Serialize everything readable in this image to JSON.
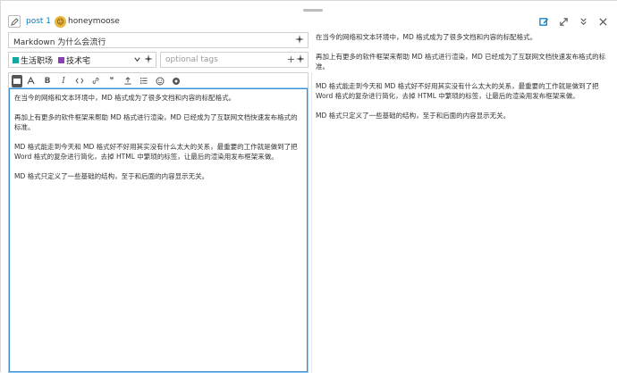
{
  "reply": {
    "post_label": "post 1",
    "username": "honeymoose",
    "avatar_glyph": "☺"
  },
  "title": {
    "value": "Markdown 为什么会流行"
  },
  "category": {
    "chips": [
      {
        "label": "生活职场",
        "color": "#12a89d"
      },
      {
        "label": "技术宅",
        "color": "#8c3fb5"
      }
    ]
  },
  "tags": {
    "placeholder": "optional tags"
  },
  "toolbar": {
    "icons": [
      "toggle-editor-icon",
      "bold-icon",
      "italic-icon",
      "link-icon",
      "quote-icon",
      "upload-icon",
      "list-icon",
      "emoji-icon",
      "options-icon"
    ],
    "bold_glyph": "B",
    "italic_glyph": "I",
    "quote_glyph": "❞"
  },
  "content": {
    "paragraphs": [
      "在当今的网络和文本环境中，MD 格式成为了很多文档和内容的标配格式。",
      "再加上有更多的软件框架来帮助 MD 格式进行渲染，MD 已经成为了互联网文档快速发布格式的标准。",
      "MD 格式能走到今天和 MD 格式好不好用其实没有什么太大的关系，最重要的工作就是做到了把 Word 格式的复杂进行简化，去掉 HTML 中繁琐的标签，让最后的渲染用发布框架来做。",
      "MD 格式只定义了一些基础的结构，至于和后面的内容显示无关。"
    ]
  },
  "colors": {
    "accent": "#0a7abf",
    "focus_border": "#3a8fd6"
  }
}
